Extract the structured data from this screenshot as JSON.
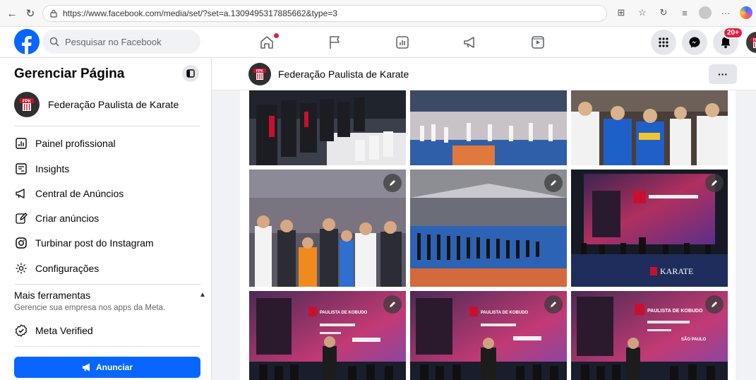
{
  "browser": {
    "url": "https://www.facebook.com/media/set/?set=a.1309495317885662&type=3"
  },
  "fb_nav": {
    "search_placeholder": "Pesquisar no Facebook",
    "notifications_count": "20+"
  },
  "sidebar": {
    "title": "Gerenciar Página",
    "page_name": "Federação Paulista de Karate",
    "items": [
      {
        "label": "Painel profissional",
        "icon": "dashboard-icon"
      },
      {
        "label": "Insights",
        "icon": "insights-icon"
      },
      {
        "label": "Central de Anúncios",
        "icon": "megaphone-icon"
      },
      {
        "label": "Criar anúncios",
        "icon": "edit-icon"
      },
      {
        "label": "Turbinar post do Instagram",
        "icon": "instagram-icon"
      },
      {
        "label": "Configurações",
        "icon": "gear-icon"
      }
    ],
    "more_tools_title": "Mais ferramentas",
    "more_tools_subtitle": "Gerencie sua empresa nos apps da Meta.",
    "meta_verified": "Meta Verified",
    "cta": "Anunciar"
  },
  "main": {
    "page_name": "Federação Paulista de Karate",
    "more_label": "···"
  },
  "logo": {
    "fpk_text": "FPK",
    "brand_color": "#0866ff"
  },
  "photos": [
    {
      "id": "p1",
      "scene": "ceremony-crowd",
      "editable": false
    },
    {
      "id": "p2",
      "scene": "arena-crowd",
      "editable": false
    },
    {
      "id": "p3",
      "scene": "athletes-line",
      "editable": false
    },
    {
      "id": "p4",
      "scene": "stands-crowd",
      "editable": true
    },
    {
      "id": "p5",
      "scene": "arena-wide",
      "editable": true
    },
    {
      "id": "p6",
      "scene": "stage-screen",
      "editable": true
    },
    {
      "id": "p7",
      "scene": "kobudo-stage",
      "editable": true
    },
    {
      "id": "p8",
      "scene": "kobudo-stage",
      "editable": true
    },
    {
      "id": "p9",
      "scene": "kobudo-stage",
      "editable": true
    }
  ],
  "screen_text": {
    "karate_banner": "KARATE",
    "kobudo_title": "PAULISTA DE KOBUDO",
    "sao_paulo": "SÃO PAULO"
  }
}
